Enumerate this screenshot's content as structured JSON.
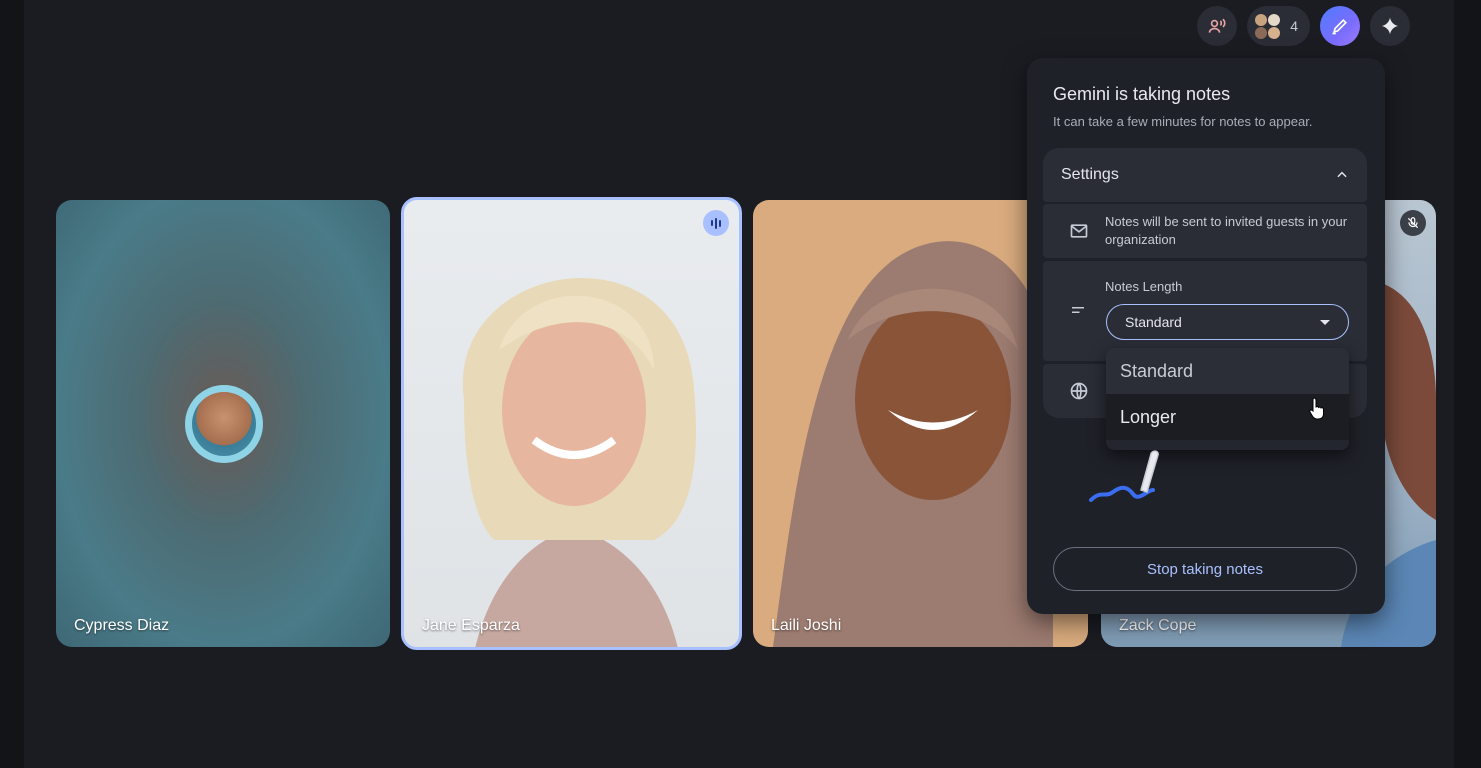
{
  "toolbar": {
    "participant_count": "4",
    "icons": [
      "voice-call-icon",
      "participants-icon",
      "take-notes-icon",
      "gemini-sparkle-icon"
    ],
    "accent_color": "#a8c0ff"
  },
  "tiles": [
    {
      "name": "Cypress Diaz",
      "state": "camera-off"
    },
    {
      "name": "Jane Esparza",
      "state": "speaking"
    },
    {
      "name": "Laili Joshi",
      "state": "video"
    },
    {
      "name": "Zack Cope",
      "state": "muted"
    }
  ],
  "panel": {
    "title": "Gemini is taking notes",
    "subtitle": "It can take a few minutes for notes to appear.",
    "settings_label": "Settings",
    "email_note": "Notes will be sent to invited guests in your organization",
    "length_label": "Notes Length",
    "length_value": "Standard",
    "length_options": [
      "Standard",
      "Longer"
    ],
    "stop_button": "Stop taking notes"
  }
}
